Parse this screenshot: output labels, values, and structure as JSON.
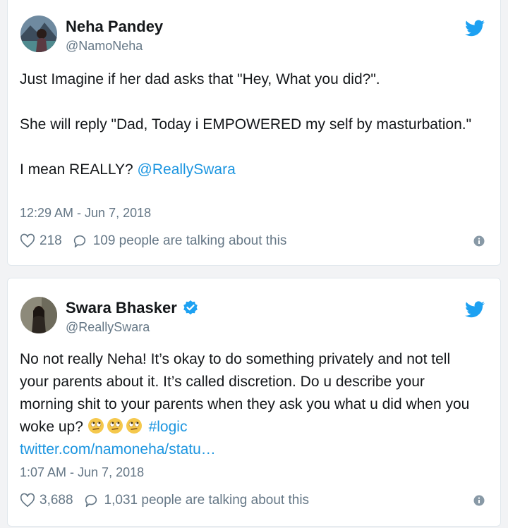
{
  "tweets": [
    {
      "name": "Neha Pandey",
      "handle": "@NamoNeha",
      "verified": false,
      "paragraphs": [
        "Just Imagine if her dad asks that \"Hey, What you did?\".",
        "She will reply \"Dad, Today i EMPOWERED my self by masturbation.\""
      ],
      "last_line_text": "I mean REALLY? ",
      "last_line_mention": "@ReallySwara",
      "timestamp": "12:29 AM - Jun 7, 2018",
      "likes": "218",
      "talking": "109 people are talking about this"
    },
    {
      "name": "Swara Bhasker",
      "handle": "@ReallySwara",
      "verified": true,
      "text": "No not really Neha! It’s okay to do something privately and not tell your parents about it. It’s called discretion. Do u describe your morning shit to your parents when they ask you what u did when you woke up? ",
      "emoji": [
        "rolling-eyes-emoji",
        "rolling-eyes-emoji",
        "rolling-eyes-emoji"
      ],
      "hashtag": "#logic",
      "url": "twitter.com/namoneha/statu…",
      "timestamp": "1:07 AM - Jun 7, 2018",
      "likes": "3,688",
      "talking": "1,031 people are talking about this"
    }
  ],
  "colors": {
    "twitter_blue": "#1da1f2",
    "link_blue": "#1b95e0",
    "muted_gray": "#657786"
  }
}
